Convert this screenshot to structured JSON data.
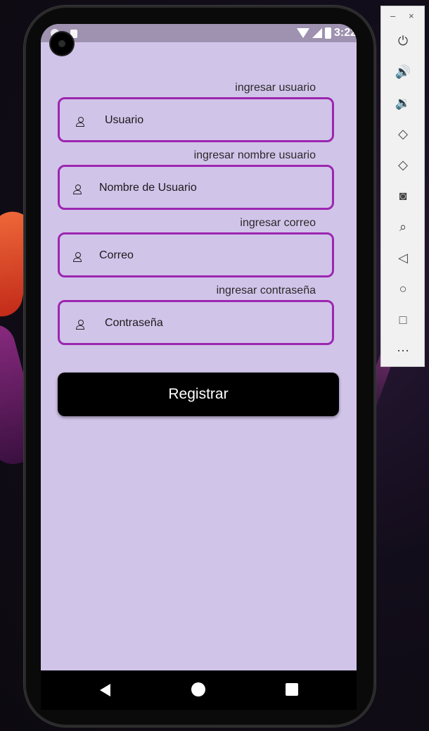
{
  "status_bar": {
    "time": "3:22"
  },
  "form": {
    "fields": [
      {
        "label": "ingresar usuario",
        "placeholder": "Usuario"
      },
      {
        "label": "ingresar nombre usuario",
        "placeholder": "Nombre de Usuario"
      },
      {
        "label": "ingresar correo",
        "placeholder": "Correo"
      },
      {
        "label": "ingresar contraseña",
        "placeholder": "Contraseña"
      }
    ],
    "submit_label": "Registrar"
  },
  "emulator_panel": {
    "minimize": "–",
    "close": "×",
    "tools": [
      "power-icon",
      "volume-up-icon",
      "volume-down-icon",
      "rotate-left-icon",
      "rotate-right-icon",
      "camera-icon",
      "zoom-icon",
      "back-icon",
      "home-icon",
      "overview-icon",
      "more-icon"
    ],
    "glyphs": {
      "power": "⏻",
      "volume_up": "🔊",
      "volume_down": "🔉",
      "rotate_left": "◇",
      "rotate_right": "◇",
      "camera": "◙",
      "zoom": "⌕",
      "back": "◁",
      "home": "○",
      "overview": "□",
      "more": "⋯"
    }
  },
  "colors": {
    "screen_bg": "#d1c4e9",
    "field_border": "#9c27b0",
    "button_bg": "#000000"
  }
}
